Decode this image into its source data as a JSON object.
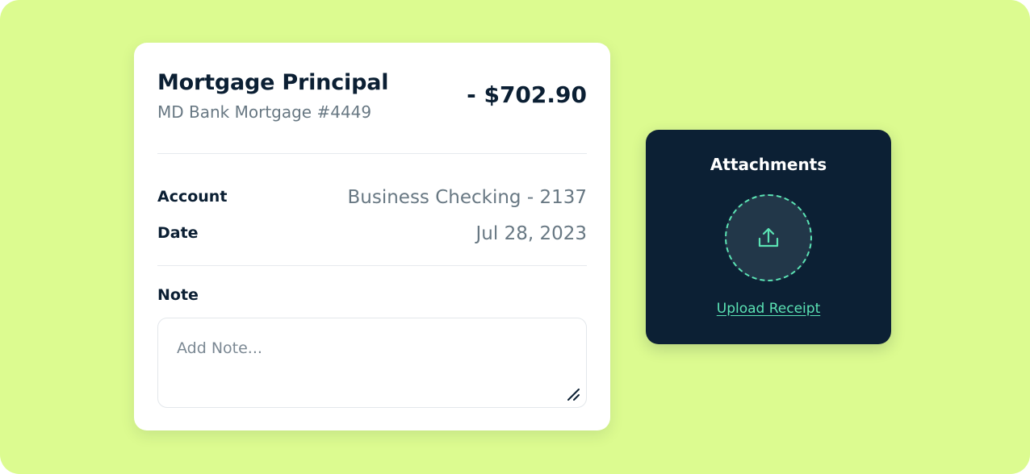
{
  "transaction": {
    "title": "Mortgage Principal",
    "subtitle": "MD Bank Mortgage #4449",
    "amount": "- $702.90",
    "fields": {
      "account_label": "Account",
      "account_value": "Business Checking - 2137",
      "date_label": "Date",
      "date_value": "Jul 28, 2023"
    },
    "note": {
      "label": "Note",
      "placeholder": "Add Note...",
      "value": ""
    }
  },
  "attachments": {
    "title": "Attachments",
    "upload_link": "Upload Receipt",
    "upload_icon": "upload-icon"
  },
  "colors": {
    "background": "#dcfb90",
    "card": "#ffffff",
    "dark_card": "#0c2034",
    "accent": "#5be3b4",
    "text_primary": "#0b1f33",
    "text_muted": "#687883"
  }
}
